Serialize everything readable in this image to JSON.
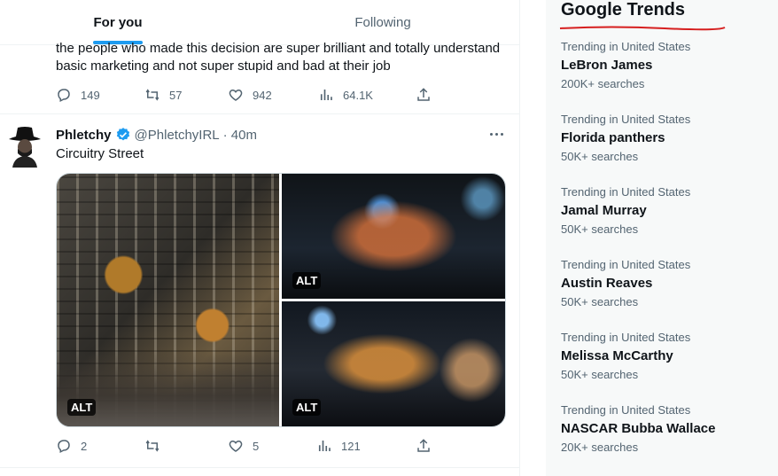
{
  "tabs": {
    "for_you": "For you",
    "following": "Following"
  },
  "prev_tweet": {
    "text": "the people who made this decision are super brilliant and totally understand basic marketing and not super stupid and bad at their job",
    "replies": "149",
    "retweets": "57",
    "likes": "942",
    "views": "64.1K"
  },
  "tweet": {
    "name": "Phletchy",
    "handle": "@PhletchyIRL",
    "time": "· 40m",
    "text": "Circuitry Street",
    "alt_labels": [
      "ALT",
      "ALT",
      "ALT"
    ],
    "replies": "2",
    "retweets": "",
    "likes": "5",
    "views": "121"
  },
  "sidebar": {
    "title": "Google Trends",
    "underline_color": "#d61f1f",
    "trends": [
      {
        "context": "Trending in United States",
        "name": "LeBron James",
        "count": "200K+ searches"
      },
      {
        "context": "Trending in United States",
        "name": "Florida panthers",
        "count": "50K+ searches"
      },
      {
        "context": "Trending in United States",
        "name": "Jamal Murray",
        "count": "50K+ searches"
      },
      {
        "context": "Trending in United States",
        "name": "Austin Reaves",
        "count": "50K+ searches"
      },
      {
        "context": "Trending in United States",
        "name": "Melissa McCarthy",
        "count": "50K+ searches"
      },
      {
        "context": "Trending in United States",
        "name": "NASCAR Bubba Wallace",
        "count": "20K+ searches"
      }
    ]
  },
  "colors": {
    "accent": "#1d9bf0",
    "verified": "#1d9bf0",
    "muted": "#536471"
  }
}
